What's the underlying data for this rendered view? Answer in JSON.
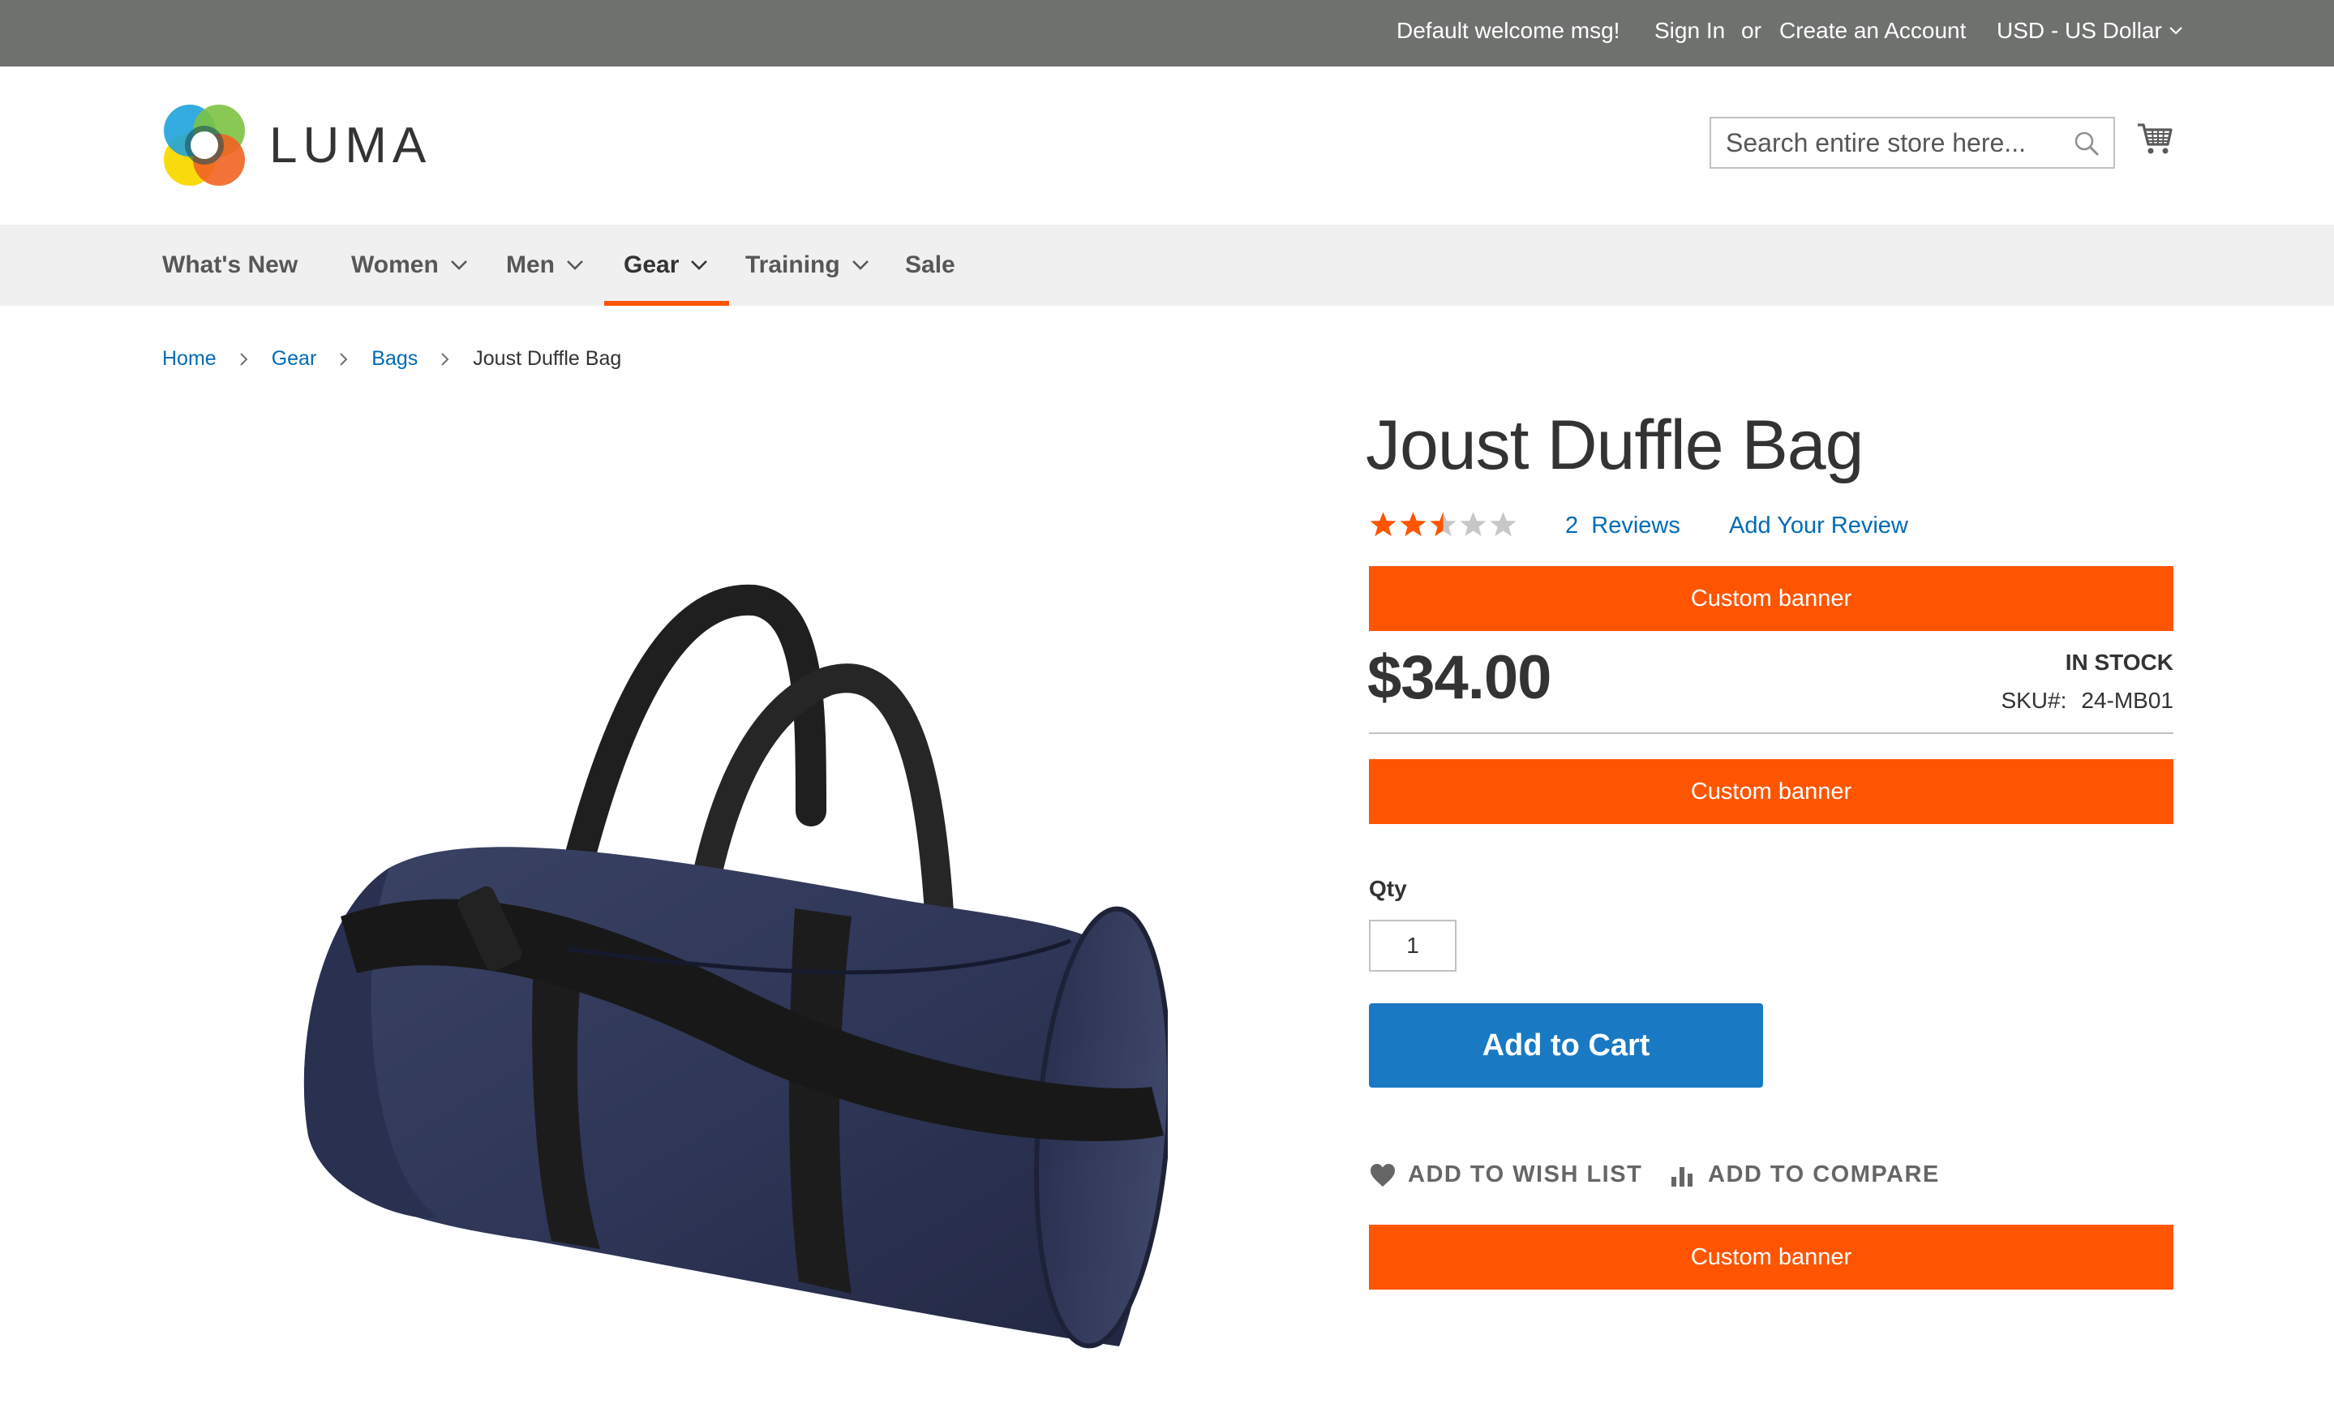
{
  "topbar": {
    "welcome": "Default welcome msg!",
    "sign_in": "Sign In",
    "or": "or",
    "create_account": "Create an Account",
    "currency": "USD - US Dollar"
  },
  "header": {
    "logo_text": "LUMA",
    "search_placeholder": "Search entire store here...",
    "search_icon": "search-icon",
    "cart_icon": "shopping-cart-icon"
  },
  "nav": {
    "items": [
      {
        "label": "What's New",
        "has_dropdown": false
      },
      {
        "label": "Women",
        "has_dropdown": true
      },
      {
        "label": "Men",
        "has_dropdown": true
      },
      {
        "label": "Gear",
        "has_dropdown": true,
        "active": true
      },
      {
        "label": "Training",
        "has_dropdown": true
      },
      {
        "label": "Sale",
        "has_dropdown": false
      }
    ]
  },
  "breadcrumb": {
    "items": [
      "Home",
      "Gear",
      "Bags"
    ],
    "current": "Joust Duffle Bag"
  },
  "product": {
    "title": "Joust Duffle Bag",
    "rating_fraction": 0.5,
    "rating_stars_total": 5,
    "reviews_count": "2",
    "reviews_label": "Reviews",
    "add_review": "Add Your Review",
    "price": "$34.00",
    "stock": "In stock",
    "sku_label": "SKU#:",
    "sku": "24-MB01",
    "qty_label": "Qty",
    "qty_value": "1",
    "add_to_cart": "Add to Cart",
    "wish_list": "Add to Wish List",
    "compare": "Add to Compare",
    "image_alt": "Navy blue duffle bag with black straps"
  },
  "banners": [
    "Custom banner",
    "Custom banner",
    "Custom banner"
  ],
  "colors": {
    "topbar_bg": "#6e716e",
    "nav_bg": "#f0f0f0",
    "accent_orange": "#ff5501",
    "link_blue": "#006bb4",
    "button_blue": "#1979c3",
    "star_filled": "#ff5501",
    "star_empty": "#c7c7c7"
  }
}
